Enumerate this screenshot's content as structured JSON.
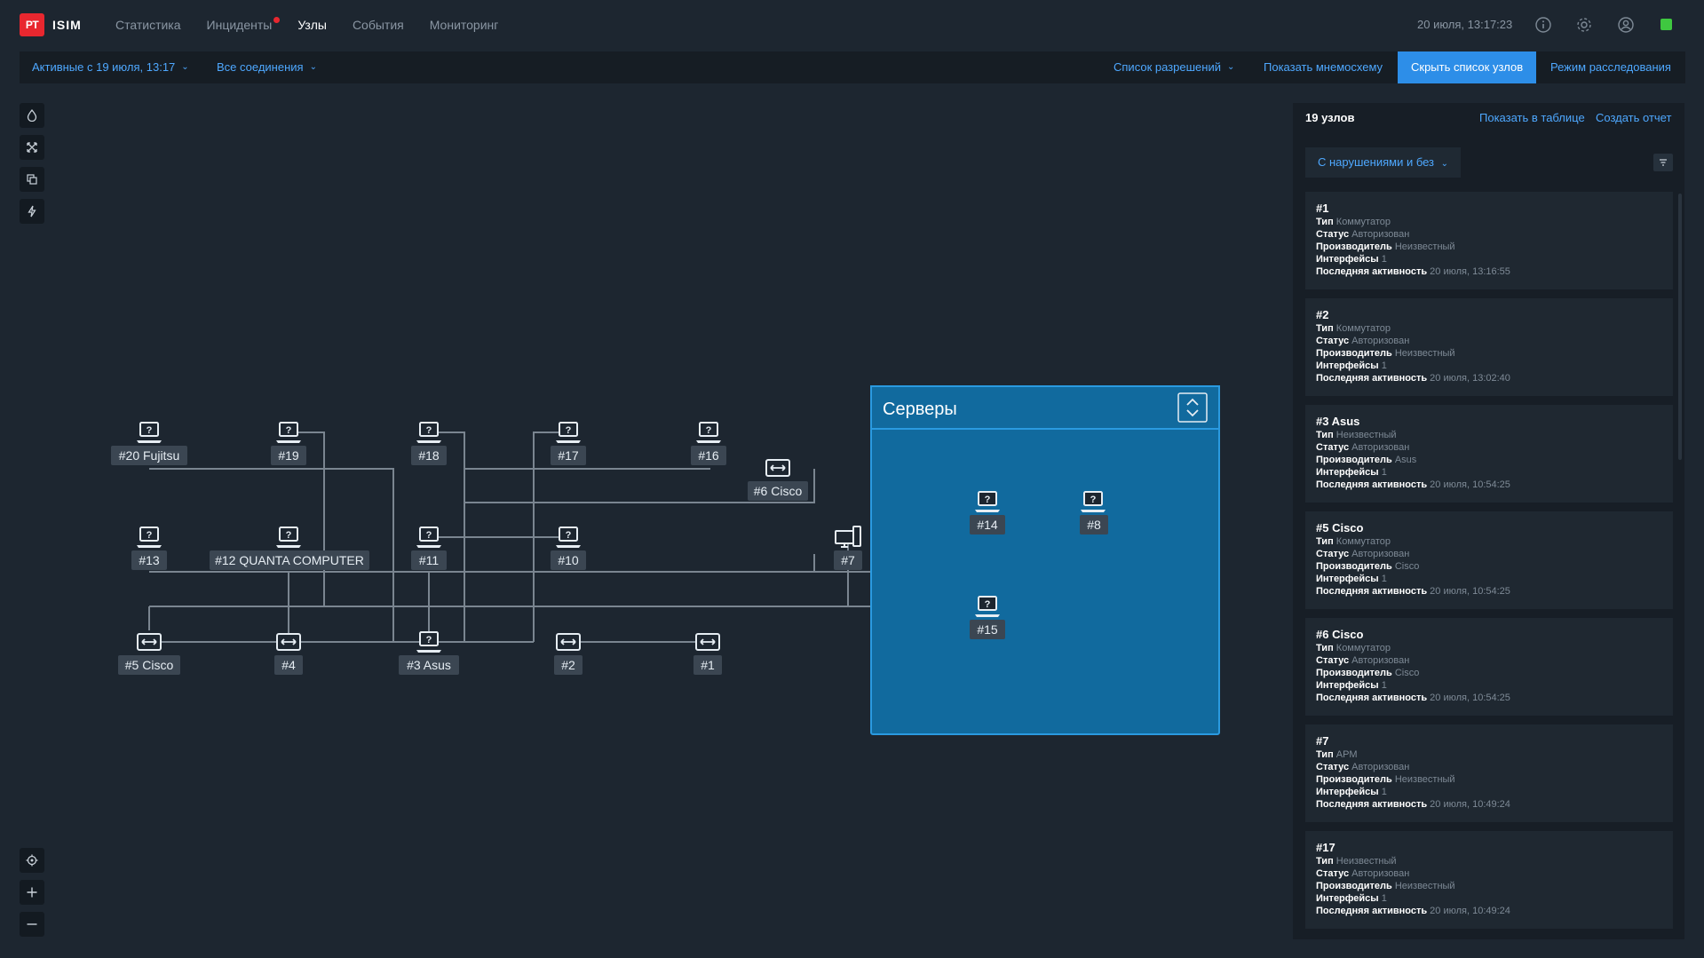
{
  "app": {
    "logo_mark": "PT",
    "logo_text": "ISIM"
  },
  "nav": [
    {
      "label": "Статистика",
      "active": false,
      "dot": false
    },
    {
      "label": "Инциденты",
      "active": false,
      "dot": true
    },
    {
      "label": "Узлы",
      "active": true,
      "dot": false
    },
    {
      "label": "События",
      "active": false,
      "dot": false
    },
    {
      "label": "Мониторинг",
      "active": false,
      "dot": false
    }
  ],
  "header": {
    "datetime": "20 июля, 13:17:23",
    "status_color": "#3fc840"
  },
  "filterbar": {
    "active_since": "Активные с 19 июля, 13:17",
    "connections": "Все соединения",
    "permissions": "Список разрешений",
    "show_scheme": "Показать мнемосхему",
    "hide_list": "Скрыть список узлов",
    "investigation": "Режим расследования"
  },
  "tools": [
    "drop-icon",
    "expand-arrows-icon",
    "copy-icon",
    "lightning-icon"
  ],
  "zoom_tools": [
    "target-icon",
    "zoom-in-icon",
    "zoom-out-icon"
  ],
  "graph": {
    "group_title": "Серверы",
    "nodes": {
      "n20": "#20 Fujitsu",
      "n19": "#19",
      "n18": "#18",
      "n17": "#17",
      "n16": "#16",
      "n6": "#6 Cisco",
      "n13": "#13",
      "n12": "#12 QUANTA COMPUTER",
      "n11": "#11",
      "n10": "#10",
      "n7": "#7",
      "n5": "#5 Cisco",
      "n4": "#4",
      "n3": "#3 Asus",
      "n2": "#2",
      "n1": "#1",
      "n14": "#14",
      "n8": "#8",
      "n15": "#15"
    }
  },
  "panel": {
    "title": "19 узлов",
    "show_table": "Показать в таблице",
    "create_report": "Создать отчет",
    "filter": "С нарушениями и без",
    "field_labels": {
      "type": "Тип",
      "status": "Статус",
      "vendor": "Производитель",
      "interfaces": "Интерфейсы",
      "last": "Последняя активность"
    },
    "cards": [
      {
        "title": "#1",
        "type": "Коммутатор",
        "status": "Авторизован",
        "vendor": "Неизвестный",
        "interfaces": "1",
        "last": "20 июля, 13:16:55"
      },
      {
        "title": "#2",
        "type": "Коммутатор",
        "status": "Авторизован",
        "vendor": "Неизвестный",
        "interfaces": "1",
        "last": "20 июля, 13:02:40"
      },
      {
        "title": "#3 Asus",
        "type": "Неизвестный",
        "status": "Авторизован",
        "vendor": "Asus",
        "interfaces": "1",
        "last": "20 июля, 10:54:25"
      },
      {
        "title": "#5 Cisco",
        "type": "Коммутатор",
        "status": "Авторизован",
        "vendor": "Cisco",
        "interfaces": "1",
        "last": "20 июля, 10:54:25"
      },
      {
        "title": "#6 Cisco",
        "type": "Коммутатор",
        "status": "Авторизован",
        "vendor": "Cisco",
        "interfaces": "1",
        "last": "20 июля, 10:54:25"
      },
      {
        "title": "#7",
        "type": "АРМ",
        "status": "Авторизован",
        "vendor": "Неизвестный",
        "interfaces": "1",
        "last": "20 июля, 10:49:24"
      },
      {
        "title": "#17",
        "type": "Неизвестный",
        "status": "Авторизован",
        "vendor": "Неизвестный",
        "interfaces": "1",
        "last": "20 июля, 10:49:24"
      }
    ]
  },
  "colors": {
    "accent": "#4ea8ff",
    "active_button": "#2d8ee8",
    "group_fill": "#116a9e",
    "group_border": "#2a9ae0",
    "brand": "#e8272f"
  }
}
